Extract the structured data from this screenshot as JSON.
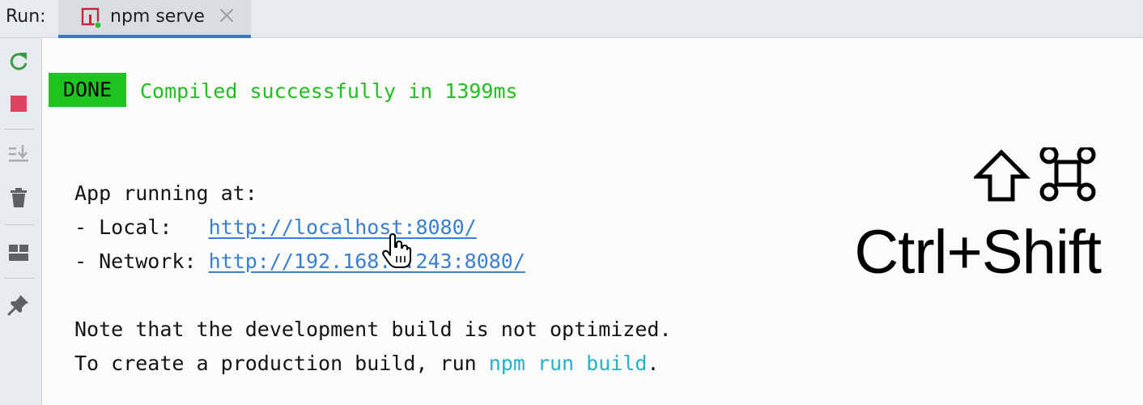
{
  "run_panel": {
    "label": "Run:",
    "tab": {
      "title": "npm serve",
      "icon": "npm-run-config-icon",
      "status": "running"
    }
  },
  "toolbar": {
    "buttons": [
      {
        "name": "rerun",
        "icon": "rerun-icon"
      },
      {
        "name": "stop",
        "icon": "stop-icon"
      },
      {
        "name": "scroll-to-end",
        "icon": "scroll-to-end-icon"
      },
      {
        "name": "clear-all",
        "icon": "trash-icon"
      },
      {
        "name": "layout",
        "icon": "layout-icon"
      },
      {
        "name": "pin-tab",
        "icon": "pin-icon"
      }
    ]
  },
  "console": {
    "badge": "DONE",
    "compiled": "Compiled successfully in 1399ms",
    "app_running": "App running at:",
    "local_label": "- Local:   ",
    "local_url": "http://localhost:8080/",
    "network_label": "- Network: ",
    "network_url": "http://192.168.1.243:8080/",
    "note": "Note that the development build is not optimized.",
    "prod_prefix": "To create a production build, run ",
    "prod_cmd": "npm run build",
    "prod_suffix": "."
  },
  "shortcut": {
    "mac_symbols": "⇧⌘",
    "text": "Ctrl+Shift"
  },
  "colors": {
    "done_badge": "#1fc31f",
    "success_text": "#22bd22",
    "link": "#3a7fd0",
    "command": "#22b3c9",
    "tab_underline": "#3b78c4",
    "stop": "#e0435e",
    "rerun": "#3d9a48"
  }
}
